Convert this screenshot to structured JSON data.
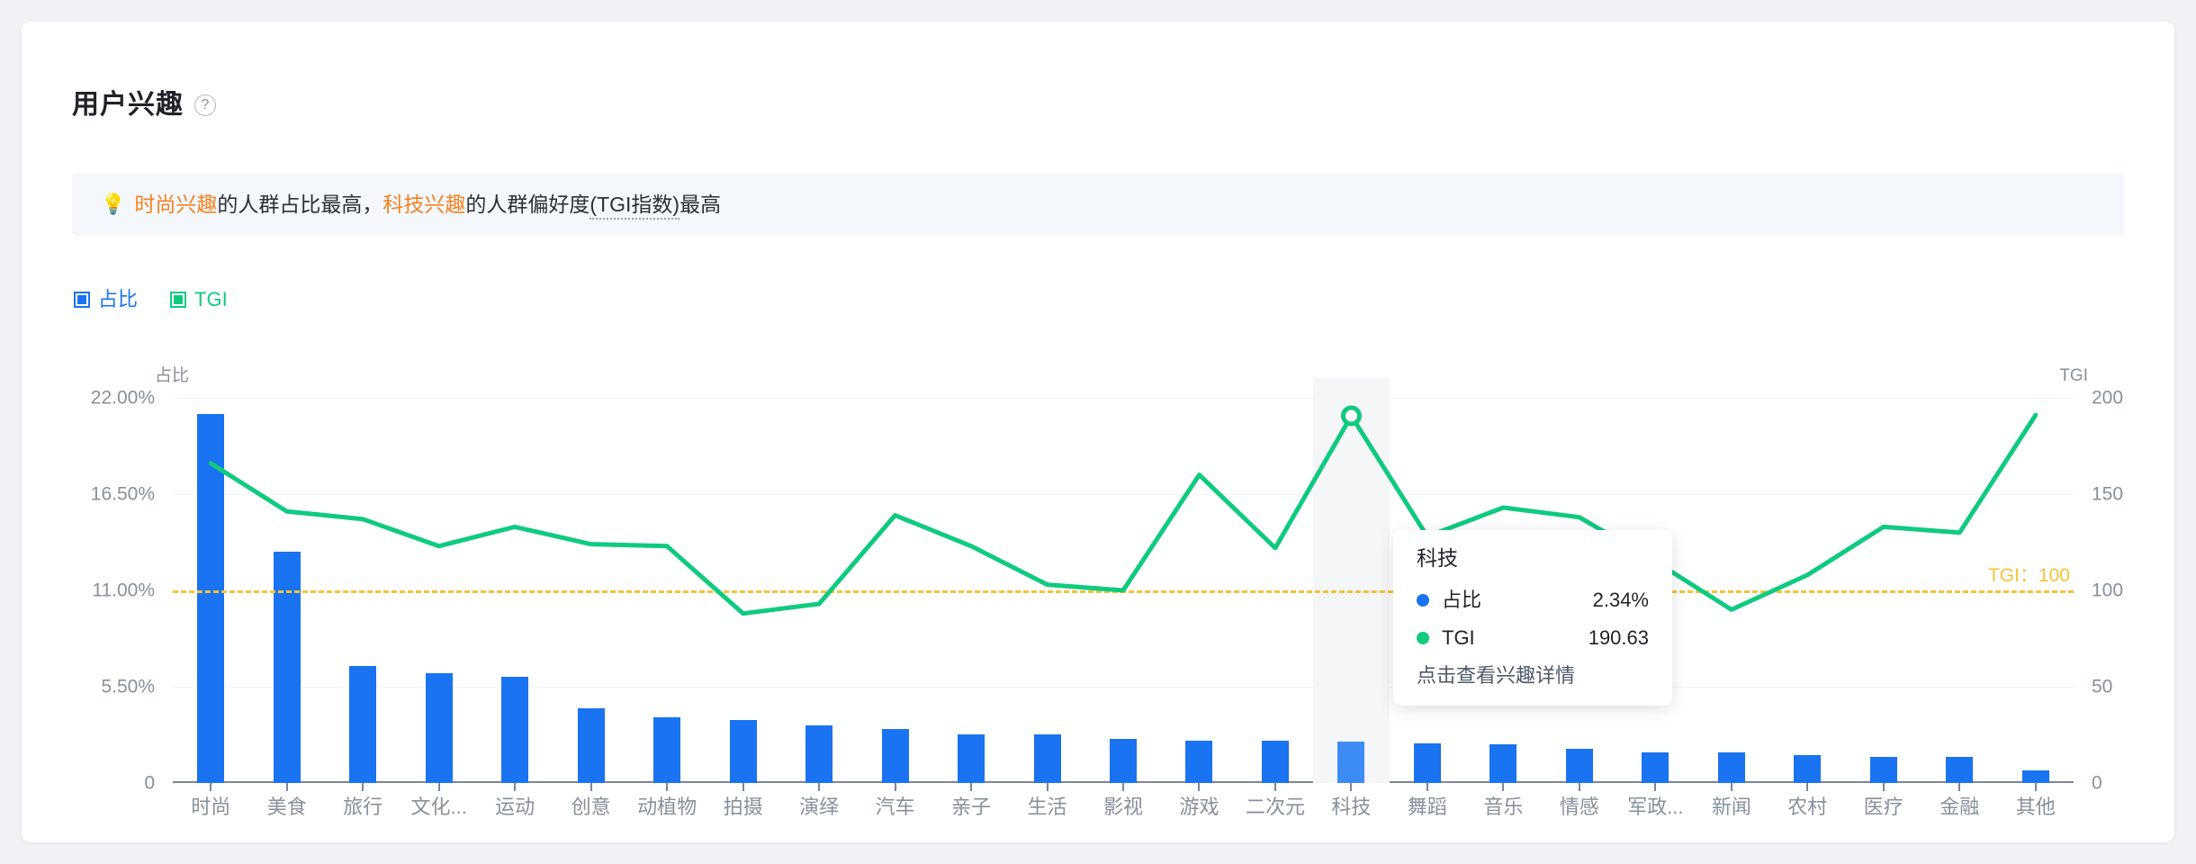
{
  "card": {
    "title": "用户兴趣",
    "help_icon": "question-circle-icon"
  },
  "insight": {
    "bulb_icon": "💡",
    "text_part1": "时尚兴趣",
    "text_part2": "的人群占比最高，",
    "text_part3": "科技兴趣",
    "text_part4": "的人群偏好度",
    "text_part5": "(TGI指数)",
    "text_part6": "最高",
    "highlight_color": "#f5811f"
  },
  "legend": [
    {
      "label": "占比",
      "color": "#1a73f0"
    },
    {
      "label": "TGI",
      "color": "#0fca7f"
    }
  ],
  "tooltip": {
    "title": "科技",
    "rows": [
      {
        "name": "占比",
        "value": "2.34%",
        "color": "#1a73f0"
      },
      {
        "name": "TGI",
        "value": "190.63",
        "color": "#0fca7f"
      }
    ],
    "footer": "点击查看兴趣详情"
  },
  "chart_data": {
    "type": "bar",
    "title": "用户兴趣",
    "xlabel": "",
    "ylabel": "占比",
    "y2label": "TGI",
    "ylim": [
      0,
      22
    ],
    "y2lim": [
      0,
      200
    ],
    "ytick_labels": [
      "0",
      "5.50%",
      "11.00%",
      "16.50%",
      "22.00%"
    ],
    "ytick_values": [
      0,
      5.5,
      11,
      16.5,
      22
    ],
    "y2tick_labels": [
      "0",
      "50",
      "100",
      "150",
      "200"
    ],
    "y2tick_values": [
      0,
      50,
      100,
      150,
      200
    ],
    "grid": true,
    "legend_position": "top-left",
    "reference_line": {
      "label": "TGI：100",
      "value": 100,
      "color": "#f7c235",
      "axis": "y2"
    },
    "highlighted_category": "科技",
    "categories": [
      "时尚",
      "美食",
      "旅行",
      "文化...",
      "运动",
      "创意",
      "动植物",
      "拍摄",
      "演绎",
      "汽车",
      "亲子",
      "生活",
      "影视",
      "游戏",
      "二次元",
      "科技",
      "舞蹈",
      "音乐",
      "情感",
      "军政...",
      "新闻",
      "农村",
      "医疗",
      "金融",
      "其他"
    ],
    "series": [
      {
        "name": "占比",
        "type": "bar",
        "axis": "y",
        "color": "#1a73f0",
        "values": [
          21.08,
          13.2,
          6.7,
          6.25,
          6.05,
          4.25,
          3.75,
          3.6,
          3.3,
          3.1,
          2.8,
          2.8,
          2.5,
          2.4,
          2.4,
          2.34,
          2.25,
          2.2,
          1.95,
          1.75,
          1.75,
          1.6,
          1.5,
          1.5,
          0.7
        ]
      },
      {
        "name": "TGI",
        "type": "line",
        "axis": "y2",
        "color": "#0fca7f",
        "values": [
          166,
          141,
          137,
          123,
          133,
          124,
          123,
          88,
          93,
          139,
          123,
          103,
          100,
          160,
          122,
          190.63,
          128,
          143,
          138,
          115,
          90,
          108,
          133,
          130,
          191
        ]
      }
    ]
  }
}
